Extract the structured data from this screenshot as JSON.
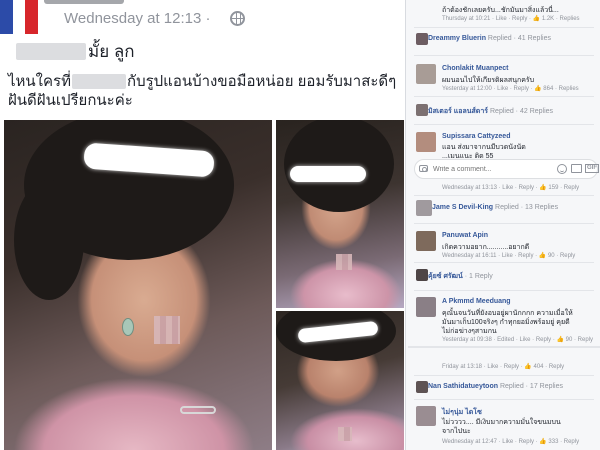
{
  "post": {
    "timestamp": "Wednesday at 12:13 · ",
    "text_line1_suffix": "มั้ย ลูก",
    "text_line2_prefix": "ไหนใครที่",
    "text_line2_middle": "กับรูปแอนบ้างขอมือหน่อย  ยอมรับมาสะดีๆ",
    "text_line3": "ฝันดีฝันเปรียกนะค่ะ",
    "privacy_icon": "globe-icon"
  },
  "comments": {
    "items": [
      {
        "text": "ถ้าต้องชักเลยครับ...ชักมันมาสิ่งแล้วนี่...",
        "meta": "Thursday at 10:21 · Like · Reply · 👍 1.2K · Replies"
      },
      {
        "name": "Dreammy Bluerin",
        "reply": "Replied · 41 Replies"
      },
      {
        "name": "Chonlakit Muanpect",
        "text": "ผมนอนไปให้เกียรติผลสนุกครับ",
        "meta": "Yesterday at 12:00 · Like · Reply · 👍 864 · Replies"
      },
      {
        "name": "มิสเตอร์ แอลนส์ดาร์",
        "reply": "Replied · 42 Replies"
      },
      {
        "name": "Supissara Cattyzeed",
        "text": "แอน ส่งมาจากนมีบวดนังนัด",
        "text2": "...เมนแนะ ติด 55"
      },
      {
        "meta": "Wednesday at 13:13 · Like · Reply · 👍 159 · Reply"
      },
      {
        "name": "Jame S Devil-King",
        "reply": "Replied · 13 Replies"
      },
      {
        "name": "Panuwat Apin",
        "text": "เกิดความอยาก...........อยากดี",
        "meta": "Wednesday at 16:11 · Like · Reply · 👍 90 · Reply"
      },
      {
        "name": "คุ้ยซ์ ศรัฒน์",
        "reply": "· 1 Reply"
      },
      {
        "name": "A Pkmmd Meeduang",
        "text": "คุณั้นจนวันที่ยังอบอยู่ผานักกกก ความเมื่อให้",
        "text2": "มันมาเก็บ100จริงๆ กำทุกยอมิ่งพร้อมยู่ คุยดี",
        "text3": "ไม่ก่อฆ่างๆสามกน",
        "meta": "Yesterday at 09:38 · Edited · Like · Reply · 👍 90 · Reply"
      },
      {
        "meta": "Friday at 13:18 · Like · Reply · 👍 404 · Reply"
      },
      {
        "name": "Nan Sathidatueytoon",
        "reply": "Replied · 17 Replies"
      },
      {
        "name": "ไม่ๆนุ่ม ไดโซ",
        "text": "ไม่วววว.... มีเงิบมากความมั่นใจขนมบน",
        "text2": "จากไปนะ",
        "meta": "Wednesday at 12:47 · Like · Reply · 👍 333 · Reply"
      }
    ],
    "write_placeholder": "Write a comment...",
    "camera_icon": "camera-icon",
    "emoji_icon": "emoji-icon",
    "photo_icon": "photo-icon",
    "gif_label": "GIF"
  },
  "colors": {
    "link": "#365899",
    "meta": "#90949c",
    "text": "#1d2129",
    "flag_blue": "#2c4ba8",
    "flag_red": "#d7262b"
  }
}
